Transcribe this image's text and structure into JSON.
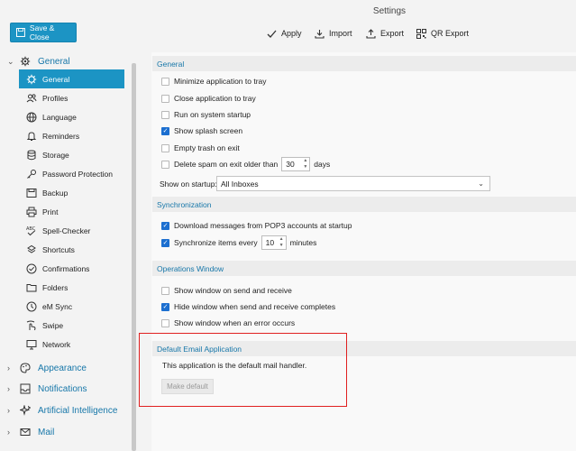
{
  "window": {
    "title": "Settings"
  },
  "toolbar": {
    "save_label": "Save & Close",
    "apply": "Apply",
    "import": "Import",
    "export": "Export",
    "qr_export": "QR Export"
  },
  "nav": {
    "general_section": "General",
    "items": [
      {
        "label": "General",
        "icon": "gear-icon"
      },
      {
        "label": "Profiles",
        "icon": "profiles-icon"
      },
      {
        "label": "Language",
        "icon": "globe-icon"
      },
      {
        "label": "Reminders",
        "icon": "bell-icon"
      },
      {
        "label": "Storage",
        "icon": "database-icon"
      },
      {
        "label": "Password Protection",
        "icon": "key-icon"
      },
      {
        "label": "Backup",
        "icon": "backup-icon"
      },
      {
        "label": "Print",
        "icon": "printer-icon"
      },
      {
        "label": "Spell-Checker",
        "icon": "spellcheck-icon"
      },
      {
        "label": "Shortcuts",
        "icon": "shortcuts-icon"
      },
      {
        "label": "Confirmations",
        "icon": "check-circle-icon"
      },
      {
        "label": "Folders",
        "icon": "folder-icon"
      },
      {
        "label": "eM Sync",
        "icon": "sync-icon"
      },
      {
        "label": "Swipe",
        "icon": "swipe-icon"
      },
      {
        "label": "Network",
        "icon": "network-icon"
      }
    ],
    "sections": [
      {
        "label": "Appearance",
        "icon": "palette-icon"
      },
      {
        "label": "Notifications",
        "icon": "notification-icon"
      },
      {
        "label": "Artificial Intelligence",
        "icon": "ai-icon"
      },
      {
        "label": "Mail",
        "icon": "mail-icon"
      }
    ]
  },
  "general": {
    "header": "General",
    "minimize_tray": "Minimize application to tray",
    "close_tray": "Close application to tray",
    "run_startup": "Run on system startup",
    "splash": "Show splash screen",
    "empty_trash": "Empty trash on exit",
    "delete_spam_pre": "Delete spam on exit older than",
    "delete_spam_value": "30",
    "delete_spam_post": "days",
    "show_on_startup_label": "Show on startup:",
    "show_on_startup_value": "All Inboxes"
  },
  "sync": {
    "header": "Synchronization",
    "download_pop3": "Download messages from POP3 accounts at startup",
    "sync_every_pre": "Synchronize items every",
    "sync_every_value": "10",
    "sync_every_post": "minutes"
  },
  "ops": {
    "header": "Operations Window",
    "show_send": "Show window on send and receive",
    "hide_complete": "Hide window when send and receive completes",
    "show_error": "Show window when an error occurs"
  },
  "default_app": {
    "header": "Default Email Application",
    "status": "This application is the default mail handler.",
    "button": "Make default"
  },
  "colors": {
    "accent": "#1c94c4",
    "highlight_box": "#e02020"
  }
}
